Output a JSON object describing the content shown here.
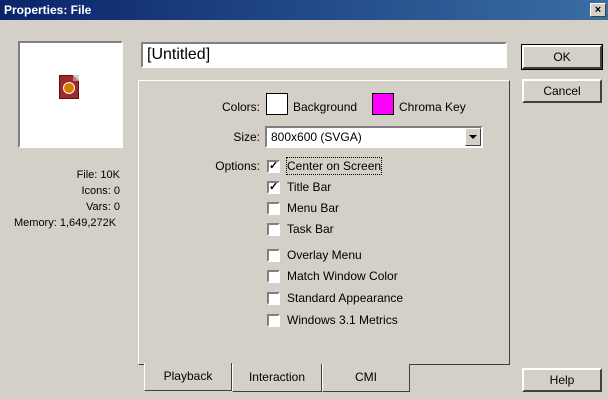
{
  "window": {
    "title": "Properties: File",
    "close_glyph": "×"
  },
  "file_info": {
    "file": "File: 10K",
    "icons": "Icons: 0",
    "vars": "Vars: 0",
    "memory": "Memory: 1,649,272K"
  },
  "name_field": {
    "value": "[Untitled]"
  },
  "playback": {
    "colors_label": "Colors:",
    "background_label": "Background",
    "background_color": "#ffffff",
    "chroma_label": "Chroma Key",
    "chroma_color": "#ff00ff",
    "size_label": "Size:",
    "size_value": "800x600 (SVGA)",
    "options_label": "Options:",
    "options": [
      {
        "label": "Center on Screen",
        "checked": true
      },
      {
        "label": "Title Bar",
        "checked": true
      },
      {
        "label": "Menu Bar",
        "checked": false
      },
      {
        "label": "Task Bar",
        "checked": false
      },
      {
        "label": "Overlay Menu",
        "checked": false
      },
      {
        "label": "Match Window Color",
        "checked": false
      },
      {
        "label": "Standard Appearance",
        "checked": false
      },
      {
        "label": "Windows 3.1 Metrics",
        "checked": false
      }
    ]
  },
  "tabs": [
    {
      "label": "Playback",
      "active": true
    },
    {
      "label": "Interaction",
      "active": false
    },
    {
      "label": "CMI",
      "active": false
    }
  ],
  "buttons": {
    "ok": "OK",
    "cancel": "Cancel",
    "help": "Help"
  },
  "check_glyph": "✓"
}
